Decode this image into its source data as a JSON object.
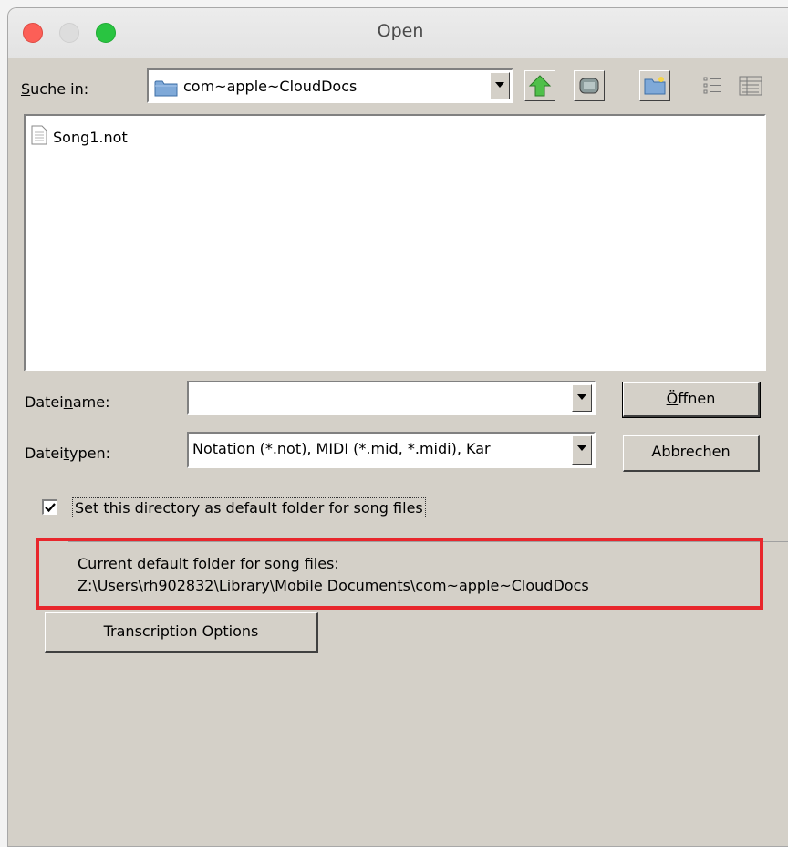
{
  "window": {
    "title": "Open"
  },
  "look_in": {
    "label_prefix": "",
    "label_underlined": "S",
    "label_rest": "uche in:",
    "value": "com~apple~CloudDocs"
  },
  "toolbar": {
    "icons": [
      "up-folder-icon",
      "desktop-icon",
      "new-folder-icon",
      "list-view-icon",
      "details-view-icon"
    ]
  },
  "files": [
    {
      "name": "Song1.not",
      "icon": "document-icon"
    }
  ],
  "filename": {
    "label_prefix": "Datei",
    "label_underlined": "n",
    "label_rest": "ame:",
    "value": ""
  },
  "filetype": {
    "label_prefix": "Datei",
    "label_underlined": "t",
    "label_rest": "ypen:",
    "value": "Notation (*.not), MIDI (*.mid, *.midi), Kar"
  },
  "buttons": {
    "open_underlined": "Ö",
    "open_rest": "ffnen",
    "cancel": "Abbrechen",
    "transcription": "Transcription Options"
  },
  "default_folder": {
    "checkbox_label": "Set this directory as default folder for song files",
    "checked": true,
    "info_line1": "Current default folder for song files:",
    "info_line2": "Z:\\Users\\rh902832\\Library\\Mobile Documents\\com~apple~CloudDocs"
  },
  "colors": {
    "highlight": "#e8262c",
    "dialog_bg": "#d4d0c8",
    "close": "#fc5f57",
    "zoom": "#29c441"
  }
}
